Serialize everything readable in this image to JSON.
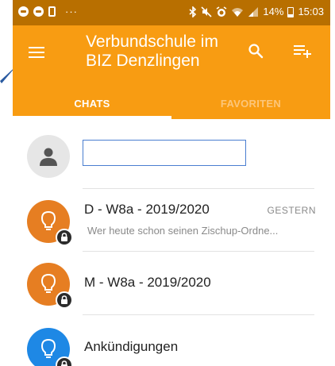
{
  "statusbar": {
    "more": "···",
    "icons_right": [
      "bluetooth-icon",
      "mute-icon",
      "alarm-icon",
      "wifi-icon",
      "signal-icon"
    ],
    "battery": "14%",
    "time": "15:03"
  },
  "appbar": {
    "title": "Verbundschule im BIZ Denzlingen",
    "color": "#f89c12"
  },
  "tabs": [
    {
      "label": "CHATS",
      "active": true
    },
    {
      "label": "FAVORITEN",
      "active": false
    }
  ],
  "new_group": {
    "input_value": ""
  },
  "chats": [
    {
      "name": "D - W8a - 2019/2020",
      "time": "GESTERN",
      "preview": "Wer heute schon seinen Zischup-Ordne...",
      "avatar_color": "#e67e22",
      "icon": "lightbulb-icon"
    },
    {
      "name": "M - W8a - 2019/2020",
      "time": "",
      "preview": "",
      "avatar_color": "#e67e22",
      "icon": "lightbulb-icon"
    },
    {
      "name": "Ankündigungen",
      "time": "",
      "preview": "",
      "avatar_color": "#1e88e5",
      "icon": "lightbulb-icon"
    }
  ]
}
